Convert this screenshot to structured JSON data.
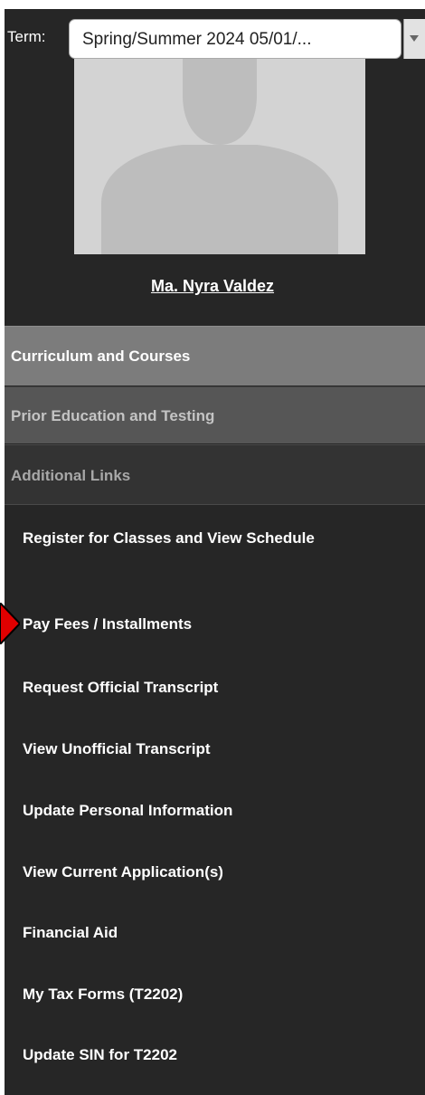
{
  "term": {
    "label": "Term:",
    "selected": "Spring/Summer 2024 05/01/..."
  },
  "profile": {
    "name": "Ma. Nyra Valdez"
  },
  "sections": {
    "curriculum": "Curriculum and Courses",
    "prior_education": "Prior Education and Testing",
    "additional_links": "Additional Links"
  },
  "links": [
    "Register for Classes and View Schedule",
    "Pay Fees / Installments",
    "Request Official Transcript",
    "View Unofficial Transcript",
    "Update Personal Information",
    "View Current Application(s)",
    "Financial Aid",
    "My Tax Forms (T2202)",
    "Update SIN for T2202"
  ],
  "colors": {
    "panel_bg": "#262626",
    "active_section": "#7c7c7c",
    "marker": "#e00000"
  }
}
